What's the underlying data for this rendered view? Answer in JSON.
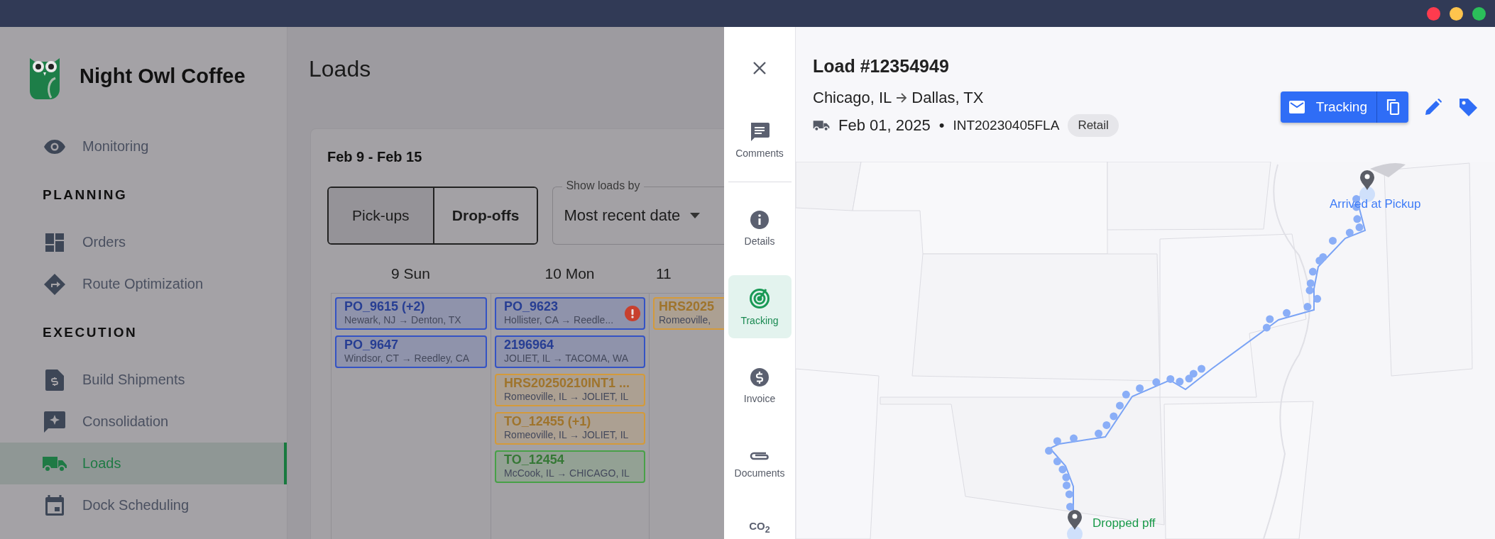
{
  "window": {
    "controls": [
      {
        "color": "#ff3b4e"
      },
      {
        "color": "#ffc44d"
      },
      {
        "color": "#2bbf5a"
      }
    ]
  },
  "sidebar": {
    "brand": "Night Owl Coffee",
    "items": [
      {
        "kind": "link",
        "label": "Monitoring",
        "selected": false
      },
      {
        "kind": "section",
        "label": "PLANNING"
      },
      {
        "kind": "link",
        "label": "Orders",
        "selected": false
      },
      {
        "kind": "link",
        "label": "Route Optimization",
        "selected": false
      },
      {
        "kind": "section",
        "label": "EXECUTION"
      },
      {
        "kind": "link",
        "label": "Build Shipments",
        "selected": false
      },
      {
        "kind": "link",
        "label": "Consolidation",
        "selected": false
      },
      {
        "kind": "link",
        "label": "Loads",
        "selected": true
      },
      {
        "kind": "link",
        "label": "Dock Scheduling",
        "selected": false
      }
    ]
  },
  "page": {
    "title": "Loads",
    "range": "Feb 9 - Feb 15",
    "toggle": [
      {
        "label": "Pick-ups",
        "selected": false
      },
      {
        "label": "Drop-offs",
        "selected": true
      }
    ],
    "show_by": {
      "label": "Show loads by",
      "value": "Most recent date"
    },
    "days": [
      {
        "header": "9 Sun",
        "loads": [
          {
            "title": "PO_9615 (+2)",
            "route": "Newark, NJ → Denton, TX",
            "color": "#3453c4",
            "alert": false
          },
          {
            "title": "PO_9647",
            "route": "Windsor, CT → Reedley, CA",
            "color": "#3453c4",
            "alert": false
          }
        ]
      },
      {
        "header": "10 Mon",
        "loads": [
          {
            "title": "PO_9623",
            "route": "Hollister, CA → Reedle...",
            "color": "#3453c4",
            "alert": true
          },
          {
            "title": "2196964",
            "route": "JOLIET, IL → TACOMA, WA",
            "color": "#3453c4",
            "alert": false
          },
          {
            "title": "HRS20250210INT1 ...",
            "route": "Romeoville, IL → JOLIET, IL",
            "color": "#d49a3a",
            "alert": false
          },
          {
            "title": "TO_12455 (+1)",
            "route": "Romeoville, IL → JOLIET, IL",
            "color": "#d49a3a",
            "alert": false
          },
          {
            "title": "TO_12454",
            "route": "McCook, IL → CHICAGO, IL",
            "color": "#48a048",
            "alert": false
          }
        ]
      },
      {
        "header": "11",
        "loads": [
          {
            "title": "HRS2025",
            "route": "Romeoville,",
            "color": "#d49a3a",
            "alert": false
          }
        ]
      }
    ]
  },
  "panel": {
    "rail": [
      {
        "label": "Comments",
        "selected": false
      },
      {
        "label": "Details",
        "selected": false
      },
      {
        "label": "Tracking",
        "selected": true
      },
      {
        "label": "Invoice",
        "selected": false
      },
      {
        "label": "Documents",
        "selected": false
      }
    ],
    "rail_glyph": "CO$_{2}$",
    "load_title": "Load #12354949",
    "origin": "Chicago, IL",
    "destination": "Dallas, TX",
    "date": "Feb 01, 2025",
    "separator": "•",
    "reference": "INT20230405FLA",
    "tag": "Retail",
    "tracking_button": "Tracking",
    "map": {
      "markers": [
        {
          "kind": "pickup",
          "label": "Arrived at Pickup"
        },
        {
          "kind": "dropoff",
          "label": "Dropped pff"
        }
      ]
    }
  }
}
